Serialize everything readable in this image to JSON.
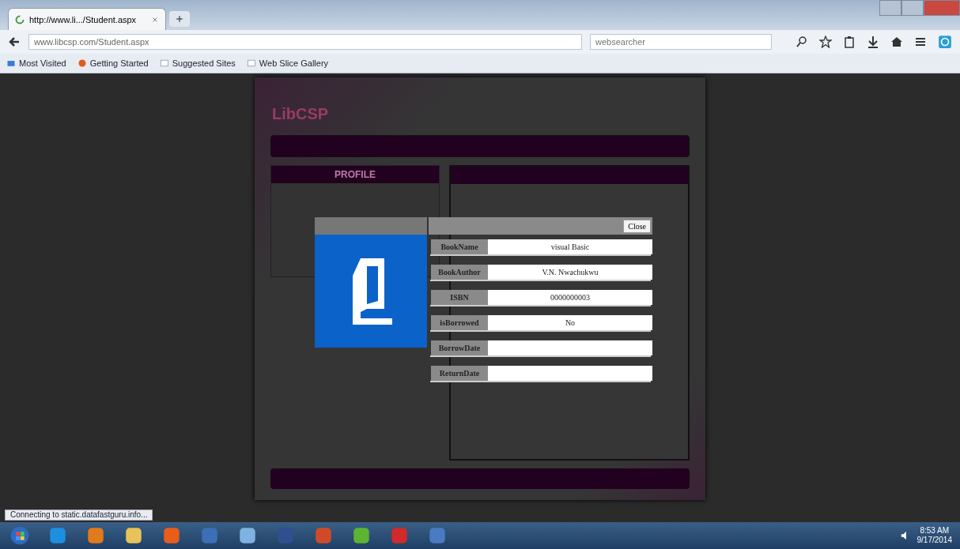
{
  "browser": {
    "tab_title": "http://www.li.../Student.aspx",
    "url": "www.libcsp.com/Student.aspx",
    "search_placeholder": "websearcher",
    "bookmarks": [
      "Most Visited",
      "Getting Started",
      "Suggested Sites",
      "Web Slice Gallery"
    ]
  },
  "page": {
    "logo": "LibCSP",
    "profile_heading": "PROFILE"
  },
  "modal": {
    "close_label": "Close",
    "fields": [
      {
        "label": "BookName",
        "value": "visual Basic"
      },
      {
        "label": "BookAuthor",
        "value": "V.N. Nwachukwu"
      },
      {
        "label": "ISBN",
        "value": "0000000003"
      },
      {
        "label": "isBorrowed",
        "value": "No"
      },
      {
        "label": "BorrowDate"
      },
      {
        "label": "ReturnDate"
      }
    ]
  },
  "status_text": "Connecting to static.datafastguru.info...",
  "taskbar": {
    "time": "8:53 AM",
    "date": "9/17/2014"
  }
}
